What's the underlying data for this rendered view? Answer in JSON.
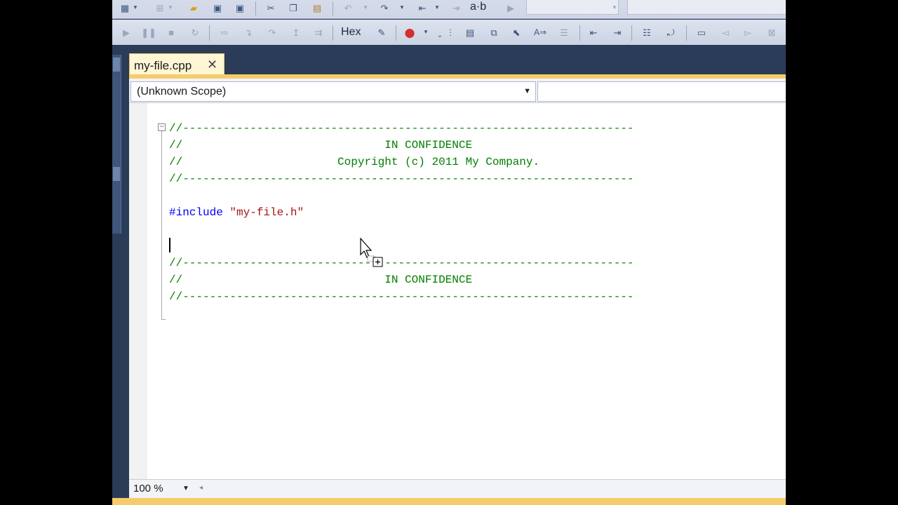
{
  "toolbar_top": {
    "icons": [
      "new-project-icon",
      "dropdown-icon",
      "add-item-icon",
      "dropdown-icon",
      "open-folder-icon",
      "save-icon",
      "save-all-icon",
      "cut-icon",
      "copy-icon",
      "paste-icon",
      "undo-icon",
      "dropdown-icon",
      "redo-icon",
      "dropdown-icon",
      "navigate-icon",
      "dropdown-icon",
      "navigate-forward-icon",
      "find-replace-icon",
      "start-debug-icon"
    ],
    "find_label": "a·b"
  },
  "toolbar_debug": {
    "hex_label": "Hex"
  },
  "tab": {
    "label": "my-file.cpp",
    "close_glyph": "✕"
  },
  "navigation": {
    "scope": "(Unknown Scope)"
  },
  "code": {
    "lines": [
      {
        "text": "//-------------------------------------------------------------------"
      },
      {
        "text": "//                              IN CONFIDENCE"
      },
      {
        "text": "//                       Copyright (c) 2011 My Company."
      },
      {
        "text": "//-------------------------------------------------------------------"
      },
      {
        "text": ""
      },
      {
        "keyword": "#include",
        "string": "\"my-file.h\""
      },
      {
        "text": ""
      },
      {
        "text": ""
      },
      {
        "text": "//-------------------------------------------------------------------"
      },
      {
        "text": "//                              IN CONFIDENCE"
      },
      {
        "text": "//-------------------------------------------------------------------"
      }
    ]
  },
  "status": {
    "zoom": "100 %"
  },
  "colors": {
    "comment": "#008000",
    "keyword": "#0000ff",
    "string": "#a31515",
    "tab_accent": "#f5cc69",
    "chrome": "#2b3c59"
  }
}
